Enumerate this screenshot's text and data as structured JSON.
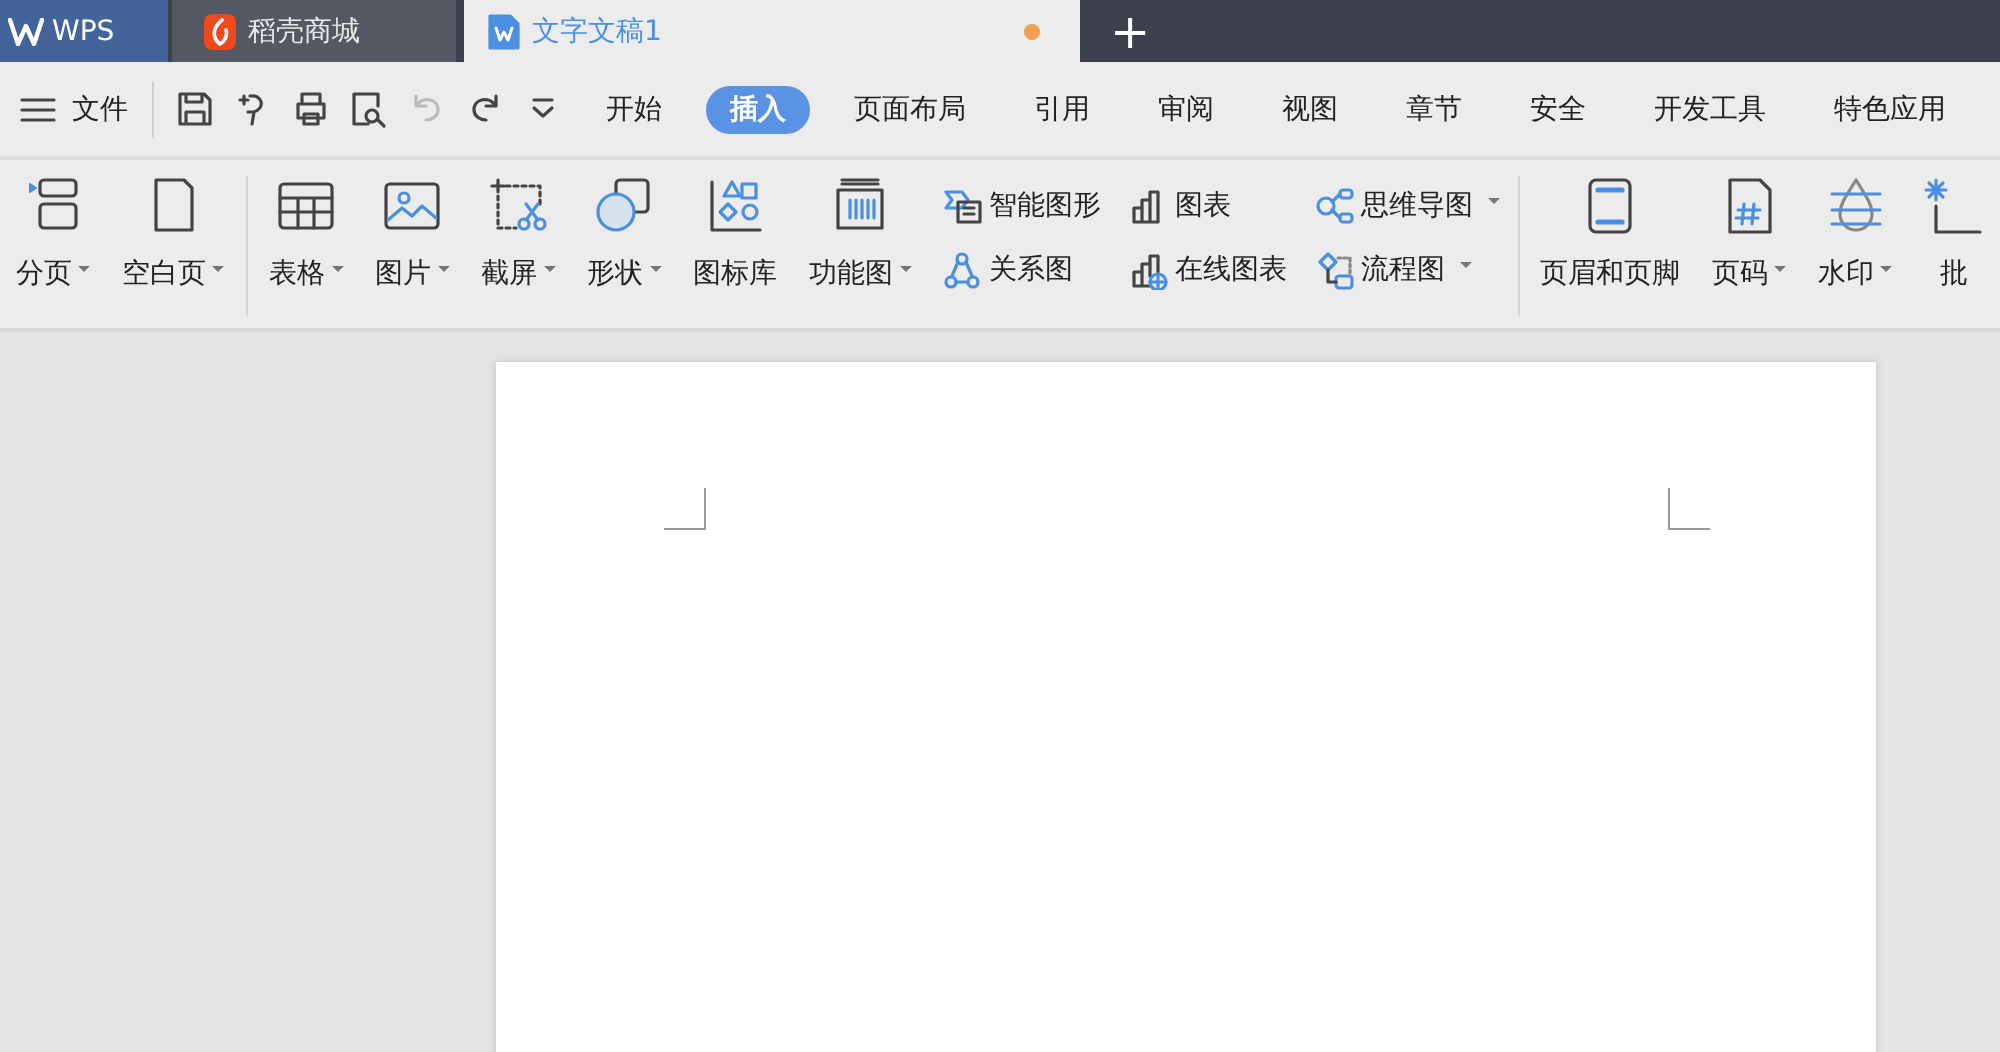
{
  "tabs": [
    {
      "kind": "home",
      "label": "WPS",
      "selected": false
    },
    {
      "kind": "store",
      "label": "稻壳商城",
      "selected": false
    },
    {
      "kind": "doc",
      "label": "文字文稿1",
      "selected": true,
      "modified": true
    }
  ],
  "new_tab": "+",
  "menu": {
    "file": "文件",
    "tabs": [
      {
        "label": "开始",
        "selected": false
      },
      {
        "label": "插入",
        "selected": true
      },
      {
        "label": "页面布局",
        "selected": false
      },
      {
        "label": "引用",
        "selected": false
      },
      {
        "label": "审阅",
        "selected": false
      },
      {
        "label": "视图",
        "selected": false
      },
      {
        "label": "章节",
        "selected": false
      },
      {
        "label": "安全",
        "selected": false
      },
      {
        "label": "开发工具",
        "selected": false
      },
      {
        "label": "特色应用",
        "selected": false
      }
    ]
  },
  "ribbon": [
    {
      "items": [
        {
          "kind": "large",
          "label": "分页",
          "dropdown": true
        },
        {
          "kind": "large",
          "label": "空白页",
          "dropdown": true
        }
      ]
    },
    {
      "items": [
        {
          "kind": "large",
          "label": "表格",
          "dropdown": true
        },
        {
          "kind": "large",
          "label": "图片",
          "dropdown": true
        },
        {
          "kind": "large",
          "label": "截屏",
          "dropdown": true
        },
        {
          "kind": "large",
          "label": "形状",
          "dropdown": true
        },
        {
          "kind": "large",
          "label": "图标库",
          "dropdown": false
        },
        {
          "kind": "large",
          "label": "功能图",
          "dropdown": true
        },
        {
          "kind": "small",
          "label": "智能图形",
          "dropdown": false
        },
        {
          "kind": "small",
          "label": "关系图",
          "dropdown": false
        },
        {
          "kind": "small",
          "label": "图表",
          "dropdown": false
        },
        {
          "kind": "small",
          "label": "在线图表",
          "dropdown": false
        },
        {
          "kind": "small",
          "label": "思维导图",
          "dropdown": true
        },
        {
          "kind": "small",
          "label": "流程图",
          "dropdown": true
        }
      ]
    },
    {
      "items": [
        {
          "kind": "large",
          "label": "页眉和页脚",
          "dropdown": false
        },
        {
          "kind": "large",
          "label": "页码",
          "dropdown": true
        },
        {
          "kind": "large",
          "label": "水印",
          "dropdown": true
        },
        {
          "kind": "large",
          "label": "批",
          "dropdown": false
        }
      ]
    }
  ]
}
